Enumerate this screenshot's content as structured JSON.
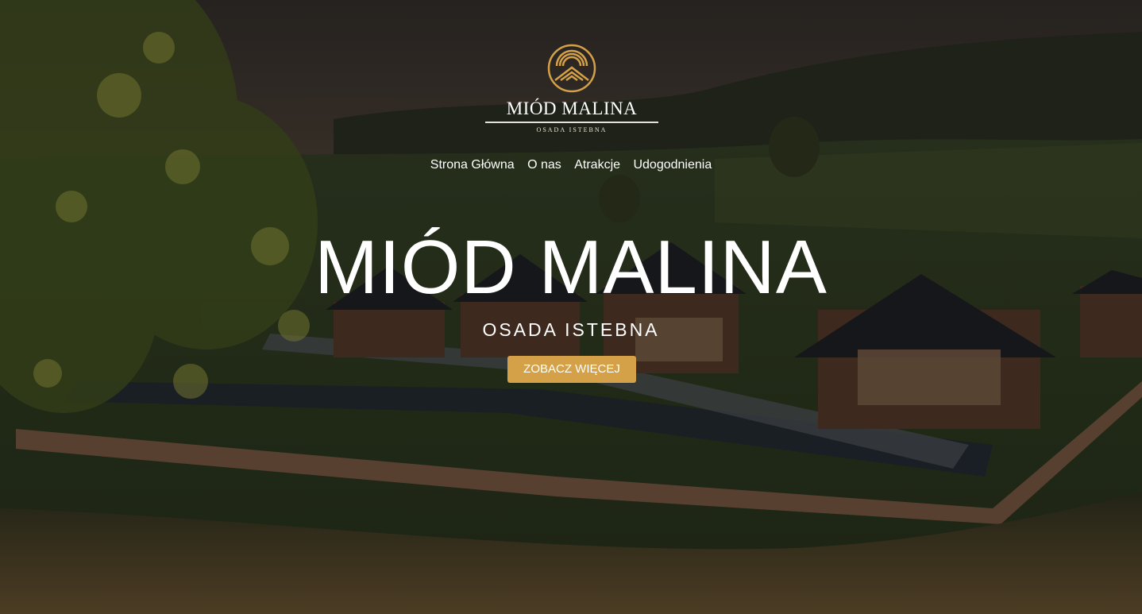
{
  "logo": {
    "brand": "MIÓD MALINA",
    "subtitle": "OSADA ISTEBNA",
    "icon": "mountain-sun-emblem-icon",
    "accent_color": "#d4a149"
  },
  "nav": {
    "items": [
      {
        "label": "Strona Główna"
      },
      {
        "label": "O nas"
      },
      {
        "label": "Atrakcje"
      },
      {
        "label": "Udogodnienia"
      }
    ]
  },
  "hero": {
    "title": "MIÓD MALINA",
    "subtitle": "OSADA ISTEBNA",
    "cta_label": "ZOBACZ WIĘCEJ",
    "cta_color": "#d4a149"
  }
}
